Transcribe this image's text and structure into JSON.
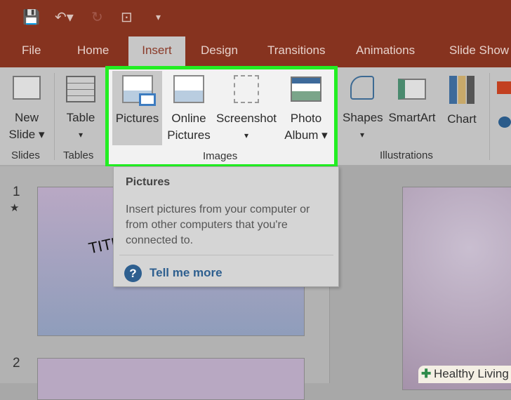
{
  "quick_access": {
    "save_icon": "save-icon",
    "undo_icon": "undo-icon",
    "redo_icon": "redo-icon",
    "present_icon": "present-icon",
    "customize_icon": "customize-icon"
  },
  "tabs": [
    "File",
    "Home",
    "Insert",
    "Design",
    "Transitions",
    "Animations",
    "Slide Show"
  ],
  "active_tab": "Insert",
  "ribbon": {
    "new_slide": "New",
    "new_slide2": "Slide",
    "table": "Table",
    "group_slides": "Slides",
    "group_tables": "Tables",
    "group_images": "Images",
    "group_illustrations": "Illustrations",
    "pictures": "Pictures",
    "online": "Online",
    "online2": "Pictures",
    "screenshot": "Screenshot",
    "photo": "Photo",
    "album": "Album",
    "shapes": "Shapes",
    "smartart": "SmartArt",
    "chart": "Chart"
  },
  "tooltip": {
    "title": "Pictures",
    "body": "Insert pictures from your computer or from other computers that you're connected to.",
    "link": "Tell me more"
  },
  "slides": {
    "s1_num": "1",
    "s1_star": "★",
    "s1_title": "TITL",
    "s2_num": "2"
  },
  "watermark": "Healthy Living",
  "colors": {
    "titlebar": "#86331f",
    "highlight": "#22ee22",
    "link": "#2e5f8f"
  }
}
